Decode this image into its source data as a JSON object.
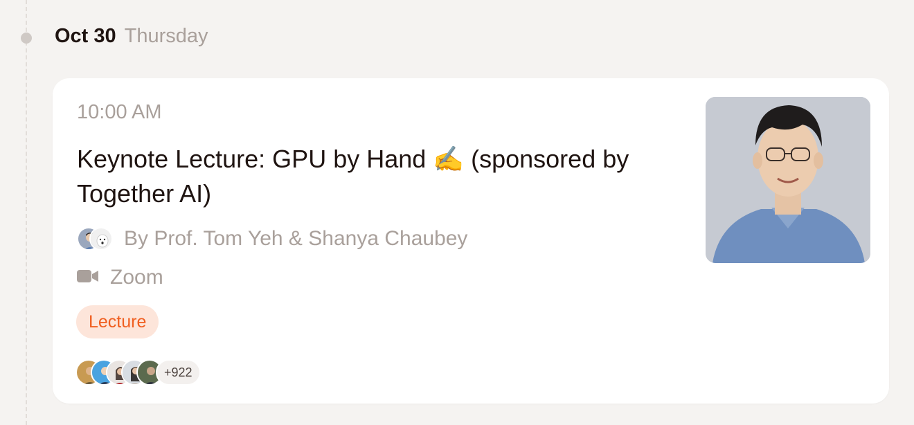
{
  "date": {
    "label": "Oct 30",
    "weekday": "Thursday"
  },
  "event": {
    "time": "10:00 AM",
    "title": "Keynote Lecture: GPU by Hand ✍️ (sponsored by Together AI)",
    "hosts": "By Prof. Tom Yeh & Shanya Chaubey",
    "location": "Zoom",
    "tag": "Lecture",
    "guest_count": "+922"
  },
  "colors": {
    "accent_tag_bg": "#fde5da",
    "accent_tag_text": "#f05e1f",
    "muted_text": "#a9a09b",
    "title_text": "#1f1411"
  },
  "icons": {
    "location": "video-camera-icon",
    "timeline": "timeline-dot-icon"
  }
}
